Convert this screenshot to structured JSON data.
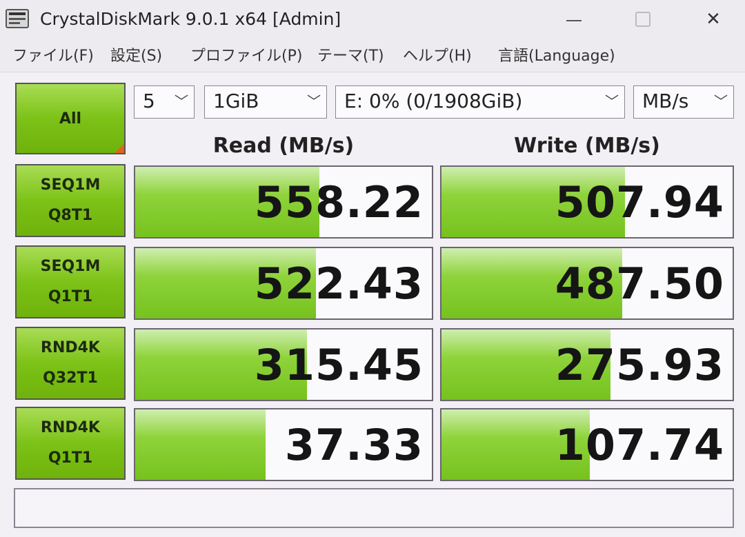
{
  "window": {
    "title": "CrystalDiskMark 9.0.1 x64 [Admin]",
    "min_glyph": "",
    "close_glyph": "✕"
  },
  "menu": {
    "items": [
      "ファイル(F)",
      "設定(S)",
      "プロファイル(P)",
      "テーマ(T)",
      "ヘルプ(H)",
      "言語(Language)"
    ]
  },
  "controls": {
    "all_label": "All",
    "count": "5",
    "size": "1GiB",
    "drive": "E: 0% (0/1908GiB)",
    "unit": "MB/s",
    "arrow": "﹀"
  },
  "headers": {
    "read": "Read (MB/s)",
    "write": "Write (MB/s)"
  },
  "tests": [
    {
      "line1": "SEQ1M",
      "line2": "Q8T1",
      "read": "558.22",
      "write": "507.94",
      "read_fill": 0.62,
      "write_fill": 0.63
    },
    {
      "line1": "SEQ1M",
      "line2": "Q1T1",
      "read": "522.43",
      "write": "487.50",
      "read_fill": 0.61,
      "write_fill": 0.62
    },
    {
      "line1": "RND4K",
      "line2": "Q32T1",
      "read": "315.45",
      "write": "275.93",
      "read_fill": 0.58,
      "write_fill": 0.58
    },
    {
      "line1": "RND4K",
      "line2": "Q1T1",
      "read": "37.33",
      "write": "107.74",
      "read_fill": 0.44,
      "write_fill": 0.51
    }
  ],
  "comment": "",
  "colors": {
    "accent_green": "#7cc217",
    "corner_orange": "#e0651a"
  }
}
